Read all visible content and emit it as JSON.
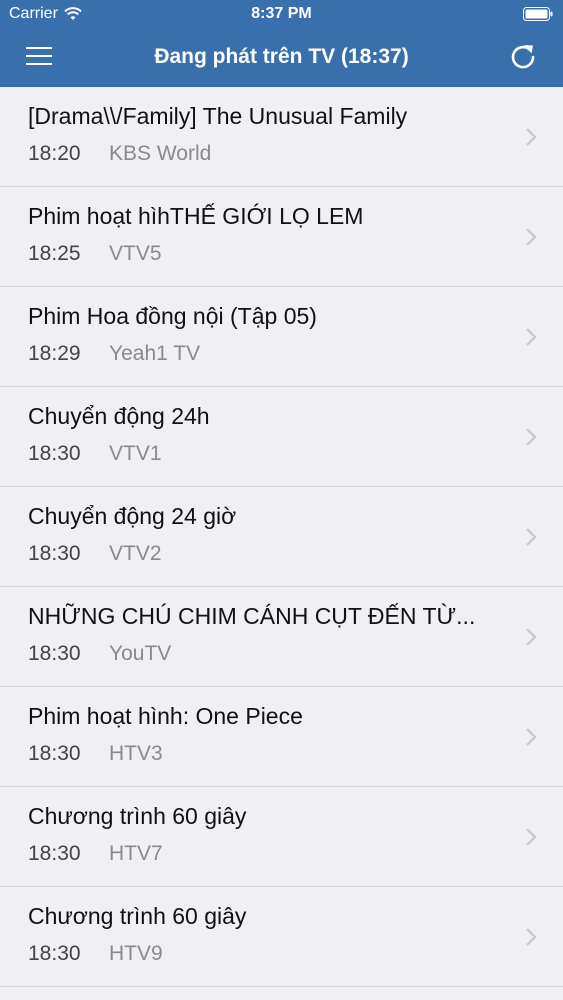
{
  "status_bar": {
    "carrier": "Carrier",
    "time": "8:37 PM"
  },
  "nav": {
    "title": "Đang phát trên TV (18:37)",
    "menu_icon": "hamburger-menu-icon",
    "refresh_icon": "refresh-icon"
  },
  "colors": {
    "header": "#3a6fae",
    "background": "#efeff4",
    "divider": "#d6d6da",
    "chevron": "#c7c7cc"
  },
  "programs": [
    {
      "title": "[Drama\\\\/Family] The Unusual Family",
      "time": "18:20",
      "channel": "KBS World"
    },
    {
      "title": "Phim hoạt hìhTHẾ GIỚI LỌ LEM",
      "time": "18:25",
      "channel": "VTV5"
    },
    {
      "title": "Phim Hoa đồng nội (Tập 05)",
      "time": "18:29",
      "channel": "Yeah1 TV"
    },
    {
      "title": "Chuyển động 24h",
      "time": "18:30",
      "channel": "VTV1"
    },
    {
      "title": "Chuyển động 24 giờ",
      "time": "18:30",
      "channel": "VTV2"
    },
    {
      "title": "NHỮNG CHÚ CHIM CÁNH CỤT ĐẾN TỪ...",
      "time": "18:30",
      "channel": "YouTV"
    },
    {
      "title": "Phim hoạt hình: One Piece",
      "time": "18:30",
      "channel": "HTV3"
    },
    {
      "title": "Chương trình 60 giây",
      "time": "18:30",
      "channel": "HTV7"
    },
    {
      "title": "Chương trình 60 giây",
      "time": "18:30",
      "channel": "HTV9"
    }
  ]
}
